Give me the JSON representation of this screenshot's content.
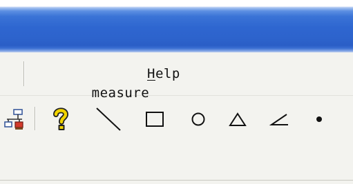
{
  "window": {
    "title_text": ""
  },
  "menubar": {
    "items": [
      {
        "label": "measure"
      },
      {
        "label": "Help",
        "mnemonic": "H",
        "rest": "elp"
      }
    ]
  },
  "toolbar": {
    "buttons": [
      {
        "name": "network-diagram-icon"
      },
      {
        "name": "help-pointer-icon"
      },
      {
        "name": "line-tool-icon"
      },
      {
        "name": "rectangle-tool-icon"
      },
      {
        "name": "circle-tool-icon"
      },
      {
        "name": "triangle-tool-icon"
      },
      {
        "name": "angle-tool-icon"
      },
      {
        "name": "point-tool-icon"
      }
    ]
  },
  "colors": {
    "titlebar_blue": "#2d63cc",
    "chrome_background": "#f3f3ef",
    "help_icon_yellow": "#f2d400"
  }
}
